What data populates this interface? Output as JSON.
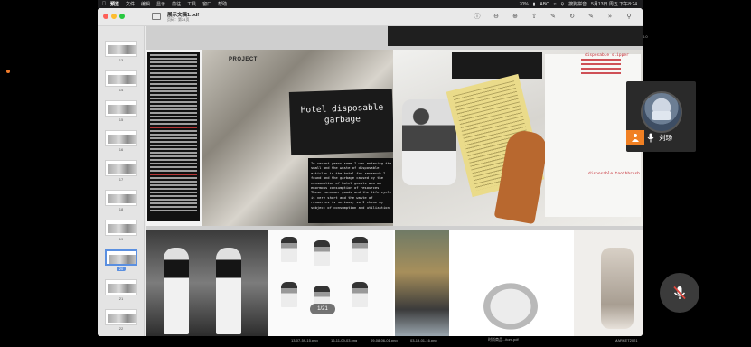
{
  "menubar": {
    "items": [
      "预览",
      "文件",
      "编辑",
      "显示",
      "前往",
      "工具",
      "窗口",
      "帮助"
    ],
    "status": [
      "70%",
      "ABC",
      "搜狗拼音",
      "5月13日 周五 下午8:24"
    ]
  },
  "window": {
    "title": "展示文稿1.pdf",
    "subtitle": "页码：第24页"
  },
  "thumbnails": [
    {
      "num": "13"
    },
    {
      "num": "14"
    },
    {
      "num": "15"
    },
    {
      "num": "16"
    },
    {
      "num": "17"
    },
    {
      "num": "18"
    },
    {
      "num": "19"
    },
    {
      "num": "20"
    },
    {
      "num": "21"
    },
    {
      "num": "22"
    }
  ],
  "selected_thumbnail": "20",
  "document": {
    "page1": {
      "project_label": "PROJECT",
      "hotel_title": "Hotel disposable garbage",
      "hotel_note": "In recent years some I was entering the small and the waste of disposable articles in the hotel for research I found and the garbage caused by the consumption of hotel guests was an enormous consumption of resources. These consumer goods and the life cycle is very short and the waste of resources is serious, so I chose my subject of consumption and utilization",
      "red_note_1": "disposable slipper",
      "red_note_2": "disposable toothbrush"
    },
    "page_counter": "1/21"
  },
  "captions": [
    "13-07-59-15.png",
    "16-11-09-03.png",
    "09-08-06-01.png",
    "03-19-01-16.png",
    "时尚商品...itom.pdf",
    "MARKET2021"
  ],
  "side_text": "0.0",
  "meeting": {
    "participant_name": "刘玚"
  },
  "colors": {
    "accent": "#5a8fe0",
    "participant_orange": "#f08023",
    "mute_red": "#e0463c"
  }
}
